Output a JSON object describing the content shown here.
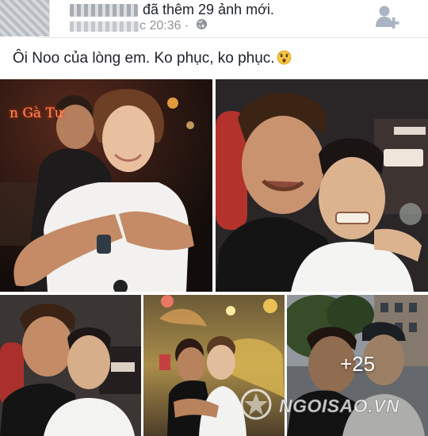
{
  "post": {
    "author_blurred": "",
    "action_text": "đã thêm 29 ảnh mới.",
    "time_suffix": "c 20:36 ·",
    "caption": "Ôi Noo của lòng em. Ko phục, ko phục.",
    "icons": {
      "privacy": "globe-icon",
      "add_friend": "add-friend-icon",
      "caption_emoji": "astonished-face-icon"
    }
  },
  "photos": [
    {
      "id": "photo-1",
      "sign_text": "n Gà Tư"
    },
    {
      "id": "photo-2"
    },
    {
      "id": "photo-3"
    },
    {
      "id": "photo-4"
    },
    {
      "id": "photo-5",
      "more_count": "+25"
    }
  ],
  "watermark": {
    "text": "NGOISAO.VN"
  },
  "colors": {
    "meta": "#90949c",
    "text": "#1d2129",
    "divider": "#e4e6eb"
  }
}
